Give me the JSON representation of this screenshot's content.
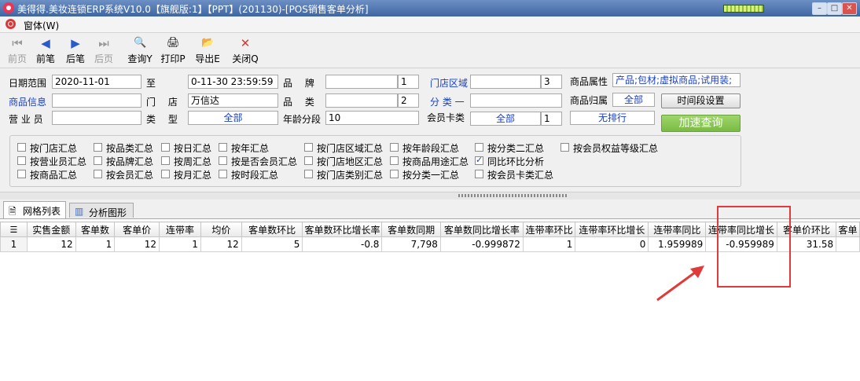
{
  "window": {
    "title": "美得得.美妆连锁ERP系统V10.0【旗舰版:1】【PPT】(201130)-[POS销售客单分析]",
    "controls": [
      "–",
      "□",
      "✕"
    ]
  },
  "menu": {
    "label": "窗体(W)"
  },
  "toolbar": {
    "buttons": [
      {
        "label": "前页",
        "icon": "⏮",
        "enabled": false
      },
      {
        "label": "前笔",
        "icon": "◀",
        "enabled": true
      },
      {
        "label": "后笔",
        "icon": "▶",
        "enabled": true
      },
      {
        "label": "后页",
        "icon": "⏭",
        "enabled": false
      },
      {
        "label": "查询Y",
        "icon": "🔍",
        "enabled": true
      },
      {
        "label": "打印P",
        "icon": "🖨",
        "enabled": true
      },
      {
        "label": "导出E",
        "icon": "📂",
        "enabled": true
      },
      {
        "label": "关闭Q",
        "icon": "✕",
        "enabled": true
      }
    ]
  },
  "filters": {
    "date_label": "日期范围",
    "date_from": "2020-11-01",
    "to_label": "至",
    "date_to": "0-11-30 23:59:59",
    "brand_label": "品　 牌",
    "brand_value": "",
    "brand_count": "1",
    "store_area_label": "门店区域",
    "store_area_value": "",
    "store_area_count": "3",
    "product_attr_label": "商品属性",
    "product_attr_value": "产品;包材;虚拟商品;试用装;",
    "product_info_label": "商品信息",
    "product_info_value": "",
    "store_label": "门　 店",
    "store_value": "万信达",
    "category_label": "品　 类",
    "category_value": "",
    "category_count": "2",
    "class1_label": "分 类 一",
    "class1_value": "",
    "product_owner_label": "商品归属",
    "product_owner_value": "全部",
    "time_period_button": "时间段设置",
    "salesman_label": "营 业 员",
    "salesman_value": "",
    "type_label": "类　 型",
    "type_value": "全部",
    "age_label": "年龄分段",
    "age_value": "10",
    "member_card_label": "会员卡类",
    "member_card_value": "全部",
    "member_card_count": "1",
    "sort_value": "无排行",
    "quick_query_button": "加速查询"
  },
  "options": [
    {
      "label": "按门店汇总",
      "checked": false
    },
    {
      "label": "按品类汇总",
      "checked": false
    },
    {
      "label": "按日汇总",
      "checked": false
    },
    {
      "label": "按年汇总",
      "checked": false
    },
    {
      "label": "按门店区域汇总",
      "checked": false
    },
    {
      "label": "按年龄段汇总",
      "checked": false
    },
    {
      "label": "按分类二汇总",
      "checked": false
    },
    {
      "label": "按会员权益等级汇总",
      "checked": false
    },
    {
      "label": "按营业员汇总",
      "checked": false
    },
    {
      "label": "按品牌汇总",
      "checked": false
    },
    {
      "label": "按周汇总",
      "checked": false
    },
    {
      "label": "按是否会员汇总",
      "checked": false
    },
    {
      "label": "按门店地区汇总",
      "checked": false
    },
    {
      "label": "按商品用途汇总",
      "checked": false
    },
    {
      "label": "同比环比分析",
      "checked": true
    },
    {
      "label": "按商品汇总",
      "checked": false
    },
    {
      "label": "按会员汇总",
      "checked": false
    },
    {
      "label": "按月汇总",
      "checked": false
    },
    {
      "label": "按时段汇总",
      "checked": false
    },
    {
      "label": "按门店类别汇总",
      "checked": false
    },
    {
      "label": "按分类一汇总",
      "checked": false
    },
    {
      "label": "按会员卡类汇总",
      "checked": false
    }
  ],
  "tabs": [
    {
      "label": "网格列表",
      "active": true
    },
    {
      "label": "分析图形",
      "active": false
    }
  ],
  "grid": {
    "corner": "",
    "columns": [
      "实售金额",
      "客单数",
      "客单价",
      "连带率",
      "均价",
      "客单数环比",
      "客单数环比增长率",
      "客单数同期",
      "客单数同比增长率",
      "连带率环比",
      "连带率环比增长",
      "连带率同比",
      "连带率同比增长",
      "客单价环比",
      "客单"
    ],
    "rows": [
      {
        "n": "1",
        "cells": [
          "12",
          "1",
          "12",
          "1",
          "12",
          "5",
          "-0.8",
          "7,798",
          "-0.999872",
          "1",
          "0",
          "1.959989",
          "-0.959989",
          "31.58",
          ""
        ]
      }
    ]
  }
}
